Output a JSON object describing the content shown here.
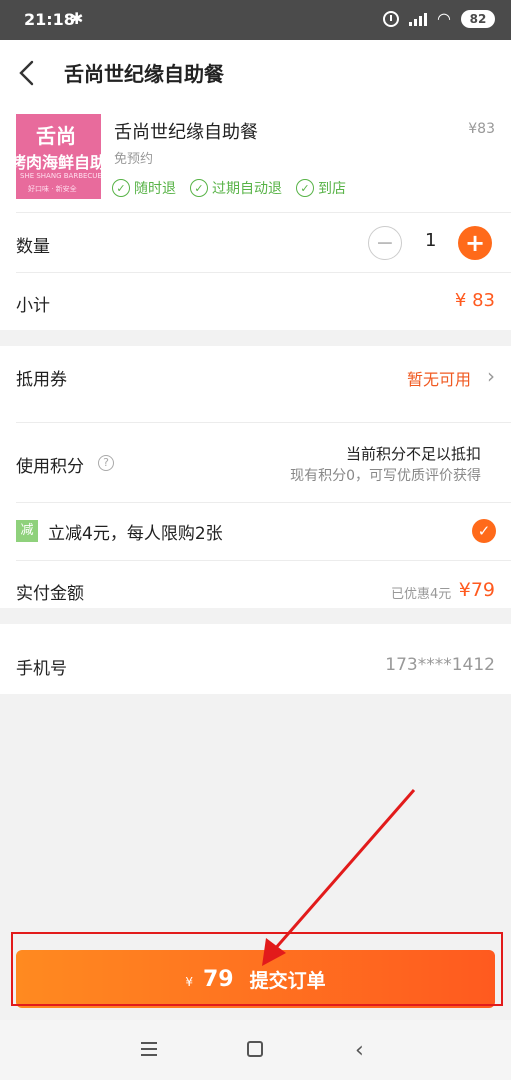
{
  "status_bar": {
    "time": "21:18",
    "battery": "82"
  },
  "header": {
    "title": "舌尚世纪缘自助餐"
  },
  "product": {
    "name": "舌尚世纪缘自助餐",
    "price": "¥83",
    "subtitle": "免预约",
    "tags": [
      "随时退",
      "过期自动退",
      "到店"
    ],
    "image_text": {
      "line1": "舌尚",
      "line2": "烤肉海鲜自助",
      "line3": "SHE SHANG BARBECUE",
      "line4": "好口味 · 新安全"
    }
  },
  "quantity": {
    "label": "数量",
    "value": "1"
  },
  "subtotal": {
    "label": "小计",
    "value": "¥ 83"
  },
  "coupon": {
    "label": "抵用券",
    "value": "暂无可用"
  },
  "points": {
    "label": "使用积分",
    "main": "当前积分不足以抵扣",
    "sub": "现有积分0，可写优质评价获得"
  },
  "promotion": {
    "badge": "减",
    "text": "立减4元，每人限购2张",
    "selected": true
  },
  "actual": {
    "label": "实付金额",
    "discount": "已优惠4元",
    "value": "¥79"
  },
  "phone": {
    "label": "手机号",
    "value": "173****1412"
  },
  "submit": {
    "currency": "¥",
    "amount": "79",
    "label": "提交订单"
  },
  "colors": {
    "accent": "#ff6a1a",
    "price": "#ff5a1f",
    "green": "#58b347",
    "annotation": "#e21b1b"
  }
}
